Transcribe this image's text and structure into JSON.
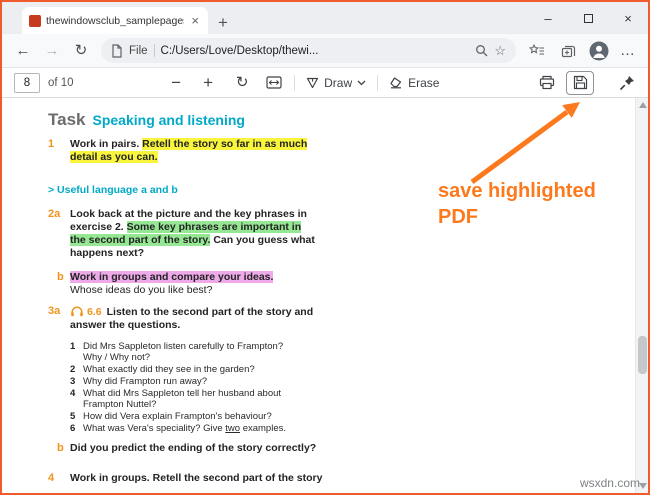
{
  "chrome": {
    "tab": {
      "title": "thewindowsclub_samplepages.p...",
      "close_glyph": "×"
    },
    "new_tab_glyph": "+",
    "window": {
      "minimize_glyph": "–",
      "close_glyph": "×"
    },
    "nav": {
      "back_glyph": "←",
      "forward_glyph": "→",
      "refresh_glyph": "↻"
    },
    "address": {
      "scheme": "File",
      "url": "C:/Users/Love/Desktop/thewi...",
      "star_glyph": "☆"
    },
    "menu_glyph": "…"
  },
  "pdfbar": {
    "page": "8",
    "of_label": "of 10",
    "minus_glyph": "−",
    "plus_glyph": "+",
    "rotate_glyph": "↻",
    "draw_label": "Draw",
    "erase_label": "Erase"
  },
  "annotation": {
    "line1": "save highlighted",
    "line2": "PDF"
  },
  "watermark": "wsxdn.com",
  "colors": {
    "accent_orange": "#f0931e",
    "annotation_orange": "#fc7a1d",
    "teal": "#00a9c7",
    "highlight_yellow": "#f8f53c",
    "highlight_green": "#96e794",
    "highlight_pink": "#eda9e8",
    "frame_border": "#ef5b2d"
  },
  "doc": {
    "heading": {
      "task": "Task",
      "subtitle": "Speaking and listening"
    },
    "ex1": {
      "num": "1",
      "pre": "Work in pairs. ",
      "hl1": "Retell the story so far in as much",
      "hl2": "detail as you can."
    },
    "useful": "> Useful language a and b",
    "ex2a": {
      "num": "2a",
      "l1": "Look back at the picture and the key phrases in",
      "l2pre": "exercise 2. ",
      "l2hl": "Some key phrases are important in",
      "l3hl": "the second part of the story.",
      "l3post": " Can you guess what",
      "l4": "happens next?"
    },
    "ex2b": {
      "num": "b",
      "hl": "Work in groups and compare your ideas.",
      "rest": "Whose ideas do you like best?"
    },
    "ex3a": {
      "num": "3a",
      "audio": "6.6",
      "l1": "Listen to the second part of the story and",
      "l2": "answer the questions.",
      "questions": [
        {
          "n": "1",
          "t1": "Did Mrs Sappleton listen carefully to Frampton?",
          "t2": "Why / Why not?"
        },
        {
          "n": "2",
          "t1": "What exactly did they see in the garden?"
        },
        {
          "n": "3",
          "t1": "Why did Frampton run away?"
        },
        {
          "n": "4",
          "t1": "What did Mrs Sappleton tell her husband about",
          "t2": "Frampton Nuttel?"
        },
        {
          "n": "5",
          "t1": "How did Vera explain Frampton's behaviour?"
        },
        {
          "n": "6",
          "t1": "What was Vera's speciality? Give ",
          "u": "two",
          "t2": " examples."
        }
      ]
    },
    "ex3b": {
      "num": "b",
      "text": "Did you predict the ending of the story correctly?"
    },
    "ex4": {
      "num": "4",
      "text": "Work in groups. Retell the second part of the story"
    }
  }
}
